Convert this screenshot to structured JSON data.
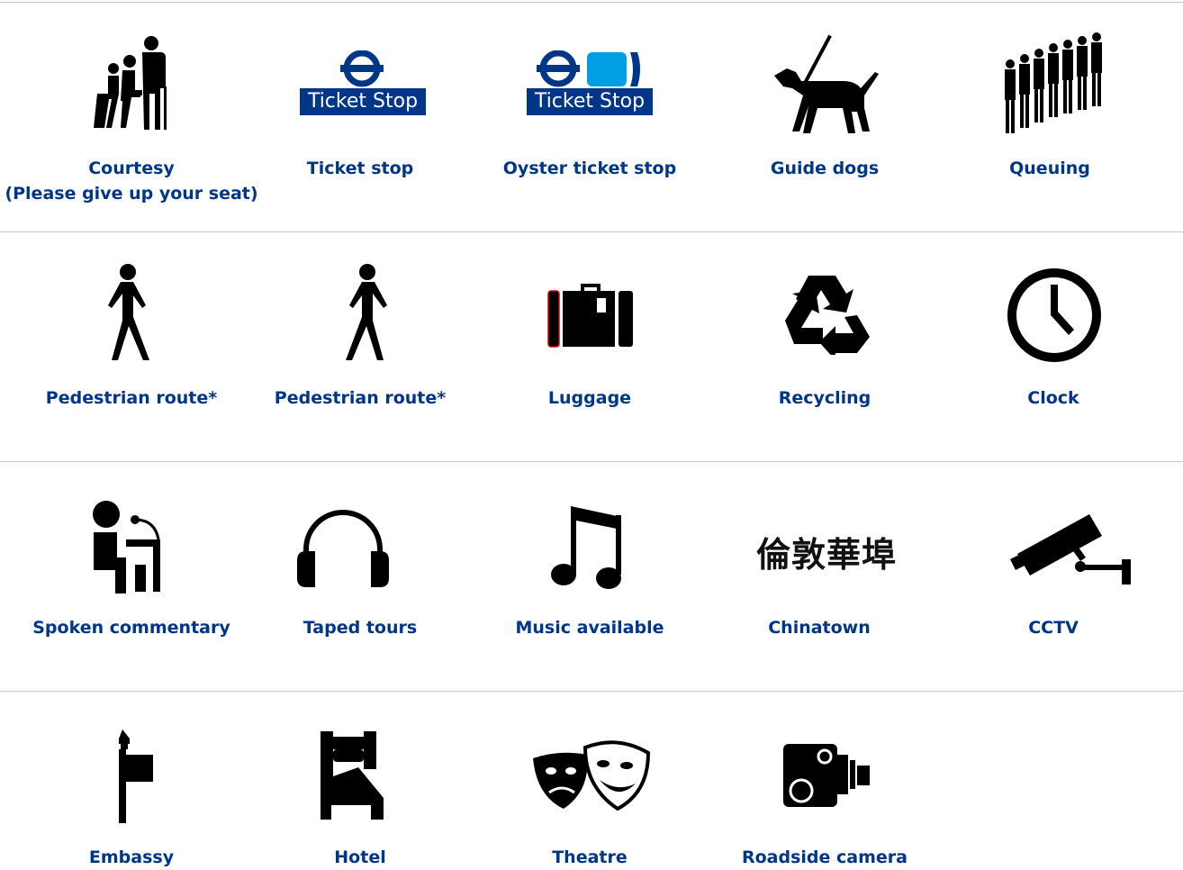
{
  "rows": [
    [
      "Courtesy\n(Please give up your seat)",
      "Ticket stop",
      "Oyster ticket stop",
      "Guide dogs",
      "Queuing"
    ],
    [
      "Pedestrian route*",
      "Pedestrian route*",
      "Luggage",
      "Recycling",
      "Clock"
    ],
    [
      "Spoken commentary",
      "Taped tours",
      "Music available",
      "Chinatown",
      "CCTV"
    ],
    [
      "Embassy",
      "Hotel",
      "Theatre",
      "Roadside camera"
    ]
  ],
  "icons": {
    "courtesy": "courtesy-icon",
    "ticket_stop": "ticket-stop-icon",
    "oyster_ticket_stop": "oyster-ticket-stop-icon",
    "guide_dogs": "guide-dog-icon",
    "queuing": "queue-icon",
    "pedestrian_1": "pedestrian-icon",
    "pedestrian_2": "pedestrian-icon",
    "luggage": "luggage-icon",
    "recycling": "recycling-icon",
    "clock": "clock-icon",
    "spoken_commentary": "spoken-commentary-icon",
    "taped_tours": "headphones-icon",
    "music": "music-note-icon",
    "chinatown": "chinatown-text-icon",
    "cctv": "cctv-icon",
    "embassy": "embassy-icon",
    "hotel": "hotel-icon",
    "theatre": "theatre-masks-icon",
    "roadside_camera": "roadside-camera-icon"
  },
  "ticket_stop_text": "Ticket Stop",
  "chinatown_text": "倫敦華埠",
  "colors": {
    "label": "#003688",
    "ticket_stop_bg": "#003688",
    "oyster_blue": "#009fe3",
    "icon": "#000000",
    "rule": "#c8c8c8"
  }
}
